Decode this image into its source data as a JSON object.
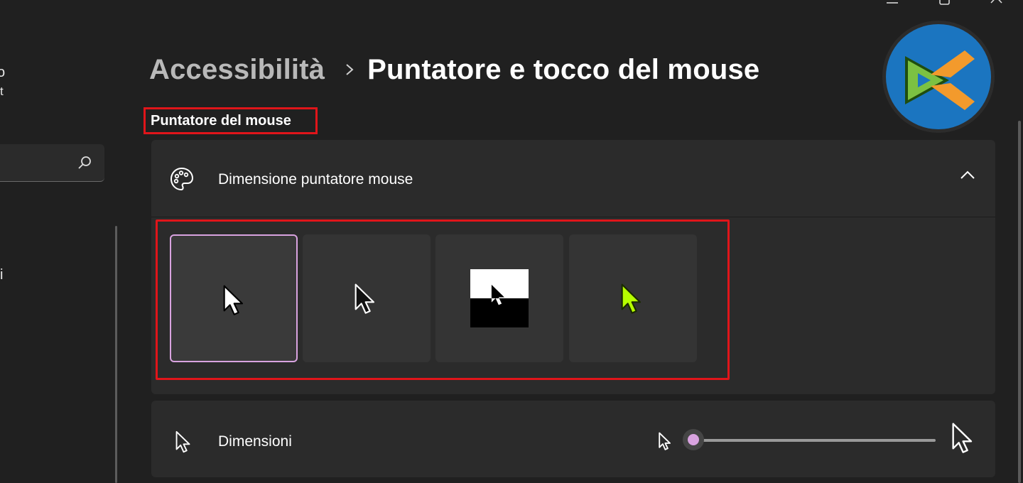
{
  "sidebar": {
    "fragment_1": "o",
    "fragment_2": "t",
    "fragment_3": "i"
  },
  "header": {
    "breadcrumb_parent": "Accessibilità",
    "breadcrumb_current": "Puntatore e tocco del mouse"
  },
  "section": {
    "title": "Puntatore del mouse"
  },
  "pointer_style": {
    "label": "Dimensione puntatore mouse",
    "icon": "palette-icon",
    "expanded": true,
    "options": [
      {
        "name": "white",
        "selected": true
      },
      {
        "name": "black",
        "selected": false
      },
      {
        "name": "inverted",
        "selected": false
      },
      {
        "name": "custom",
        "selected": false,
        "color": "#b6ff00"
      }
    ]
  },
  "size": {
    "label": "Dimensioni",
    "slider_value_fraction": 0.0
  },
  "colors": {
    "background": "#202020",
    "card": "#2b2b2b",
    "accent": "#d9a3e0",
    "highlight_outline": "#e0151a",
    "custom_cursor": "#b6ff00"
  }
}
